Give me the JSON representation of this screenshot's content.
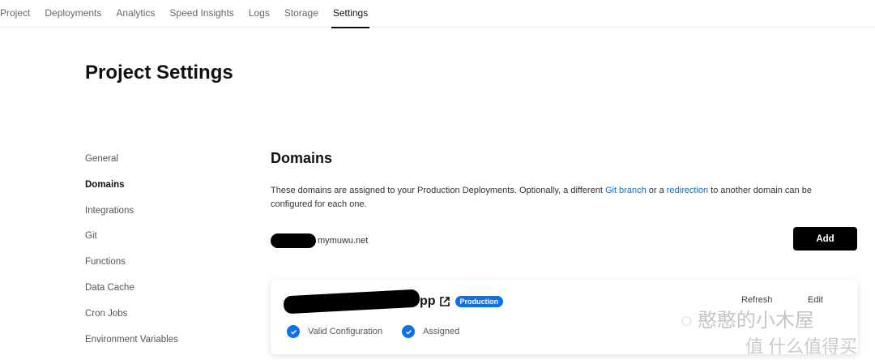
{
  "tabs": [
    {
      "label": "Project"
    },
    {
      "label": "Deployments"
    },
    {
      "label": "Analytics"
    },
    {
      "label": "Speed Insights"
    },
    {
      "label": "Logs"
    },
    {
      "label": "Storage"
    },
    {
      "label": "Settings",
      "active": true
    }
  ],
  "page_title": "Project Settings",
  "sidebar": {
    "items": [
      {
        "label": "General"
      },
      {
        "label": "Domains",
        "active": true
      },
      {
        "label": "Integrations"
      },
      {
        "label": "Git"
      },
      {
        "label": "Functions"
      },
      {
        "label": "Data Cache"
      },
      {
        "label": "Cron Jobs"
      },
      {
        "label": "Environment Variables"
      }
    ]
  },
  "domains": {
    "heading": "Domains",
    "desc_1": "These domains are assigned to your Production Deployments. Optionally, a different ",
    "link_git": "Git branch",
    "desc_2": " or a ",
    "link_redirect": "redirection",
    "desc_3": " to another domain can be configured for each one.",
    "input_domain_visible": "mymuwu.net",
    "add_label": "Add",
    "card": {
      "name_visible": "pp",
      "badge": "Production",
      "refresh": "Refresh",
      "edit": "Edit",
      "status_1": "Valid Configuration",
      "status_2": "Assigned"
    }
  },
  "watermark": {
    "line1": "憨憨的小木屋",
    "line2": "值 什么值得买"
  },
  "colors": {
    "accent": "#0a72ef",
    "link": "#0a6fd6",
    "button": "#000000"
  }
}
